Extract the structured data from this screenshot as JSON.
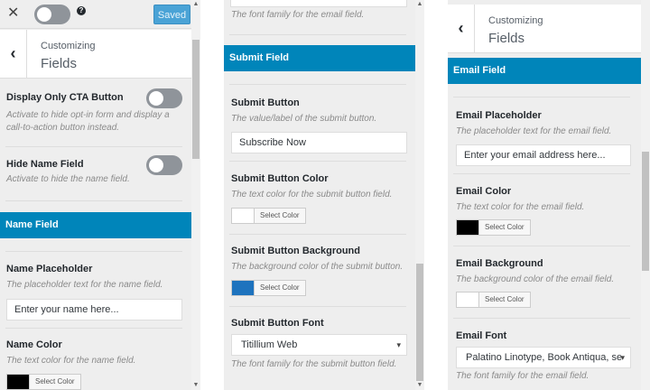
{
  "panel1": {
    "close_label": "✕",
    "help_label": "?",
    "saved_label": "Saved",
    "customizing": "Customizing",
    "section_title": "Fields",
    "display_cta_title": "Display Only CTA Button",
    "display_cta_desc": "Activate to hide opt-in form and display a call-to-action button instead.",
    "hide_name_title": "Hide Name Field",
    "hide_name_desc": "Activate to hide the name field.",
    "name_field_heading": "Name Field",
    "name_placeholder_title": "Name Placeholder",
    "name_placeholder_desc": "The placeholder text for the name field.",
    "name_placeholder_value": "Enter your name here...",
    "name_color_title": "Name Color",
    "name_color_desc": "The text color for the name field.",
    "select_color": "Select Color"
  },
  "panel2": {
    "top_desc": "The font family for the email field.",
    "submit_field_heading": "Submit Field",
    "submit_button_title": "Submit Button",
    "submit_button_desc": "The value/label of the submit button.",
    "submit_button_value": "Subscribe Now",
    "submit_color_title": "Submit Button Color",
    "submit_color_desc": "The text color for the submit button field.",
    "submit_bg_title": "Submit Button Background",
    "submit_bg_desc": "The background color of the submit button.",
    "submit_font_title": "Submit Button Font",
    "submit_font_value": "Titillium Web",
    "submit_font_desc": "The font family for the submit button field.",
    "select_color": "Select Color"
  },
  "panel3": {
    "customizing": "Customizing",
    "section_title": "Fields",
    "email_field_heading": "Email Field",
    "email_placeholder_title": "Email Placeholder",
    "email_placeholder_desc": "The placeholder text for the email field.",
    "email_placeholder_value": "Enter your email address here...",
    "email_color_title": "Email Color",
    "email_color_desc": "The text color for the email field.",
    "email_bg_title": "Email Background",
    "email_bg_desc": "The background color of the email field.",
    "email_font_title": "Email Font",
    "email_font_value": "Palatino Linotype, Book Antiqua, se",
    "email_font_desc": "The font family for the email field.",
    "select_color": "Select Color"
  },
  "colors": {
    "accent": "#0085ba",
    "name_color": "#000000",
    "submit_color": "#ffffff",
    "submit_background": "#1e73be",
    "email_color": "#000000",
    "email_background": "#ffffff"
  },
  "icons": {
    "close": "close-icon",
    "help": "help-icon",
    "back": "chevron-left-icon",
    "select_arrow": "chevron-down-icon"
  }
}
